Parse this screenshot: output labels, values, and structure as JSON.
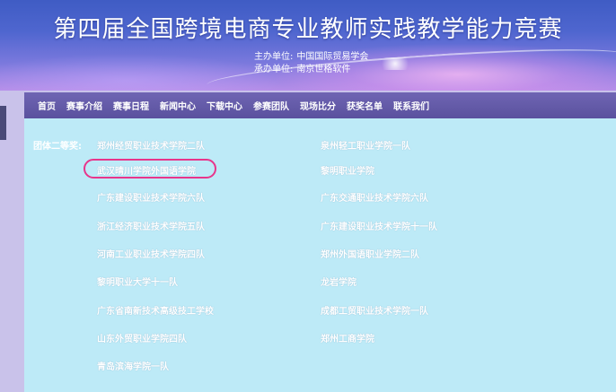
{
  "banner": {
    "title": "第四届全国跨境电商专业教师实践教学能力竞赛",
    "organizer_label": "主办单位:",
    "organizer": "中国国际贸易学会",
    "contractor_label": "承办单位:",
    "contractor": "南京世格软件"
  },
  "nav": {
    "items": [
      "首页",
      "赛事介绍",
      "赛事日程",
      "新闻中心",
      "下载中心",
      "参赛团队",
      "现场比分",
      "获奖名单",
      "联系我们"
    ]
  },
  "awards": {
    "group_label": "团体二等奖:",
    "left_column": [
      "郑州经贸职业技术学院二队",
      "武汉晴川学院外国语学院",
      "广东建设职业技术学院六队",
      "浙江经济职业技术学院五队",
      "河南工业职业技术学院四队",
      "黎明职业大学十一队",
      "广东省南新技术高级技工学校",
      "山东外贸职业学院四队",
      "青岛滨海学院一队"
    ],
    "right_column": [
      "泉州轻工职业学院一队",
      "黎明职业学院",
      "广东交通职业技术学院六队",
      "广东建设职业技术学院十一队",
      "郑州外国语职业学院二队",
      "龙岩学院",
      "成都工贸职业技术学院一队",
      "郑州工商学院"
    ]
  },
  "colors": {
    "accent_highlight": "#e8358b",
    "nav_bg": "#5f56a6",
    "content_bg": "#bdeaf7"
  }
}
